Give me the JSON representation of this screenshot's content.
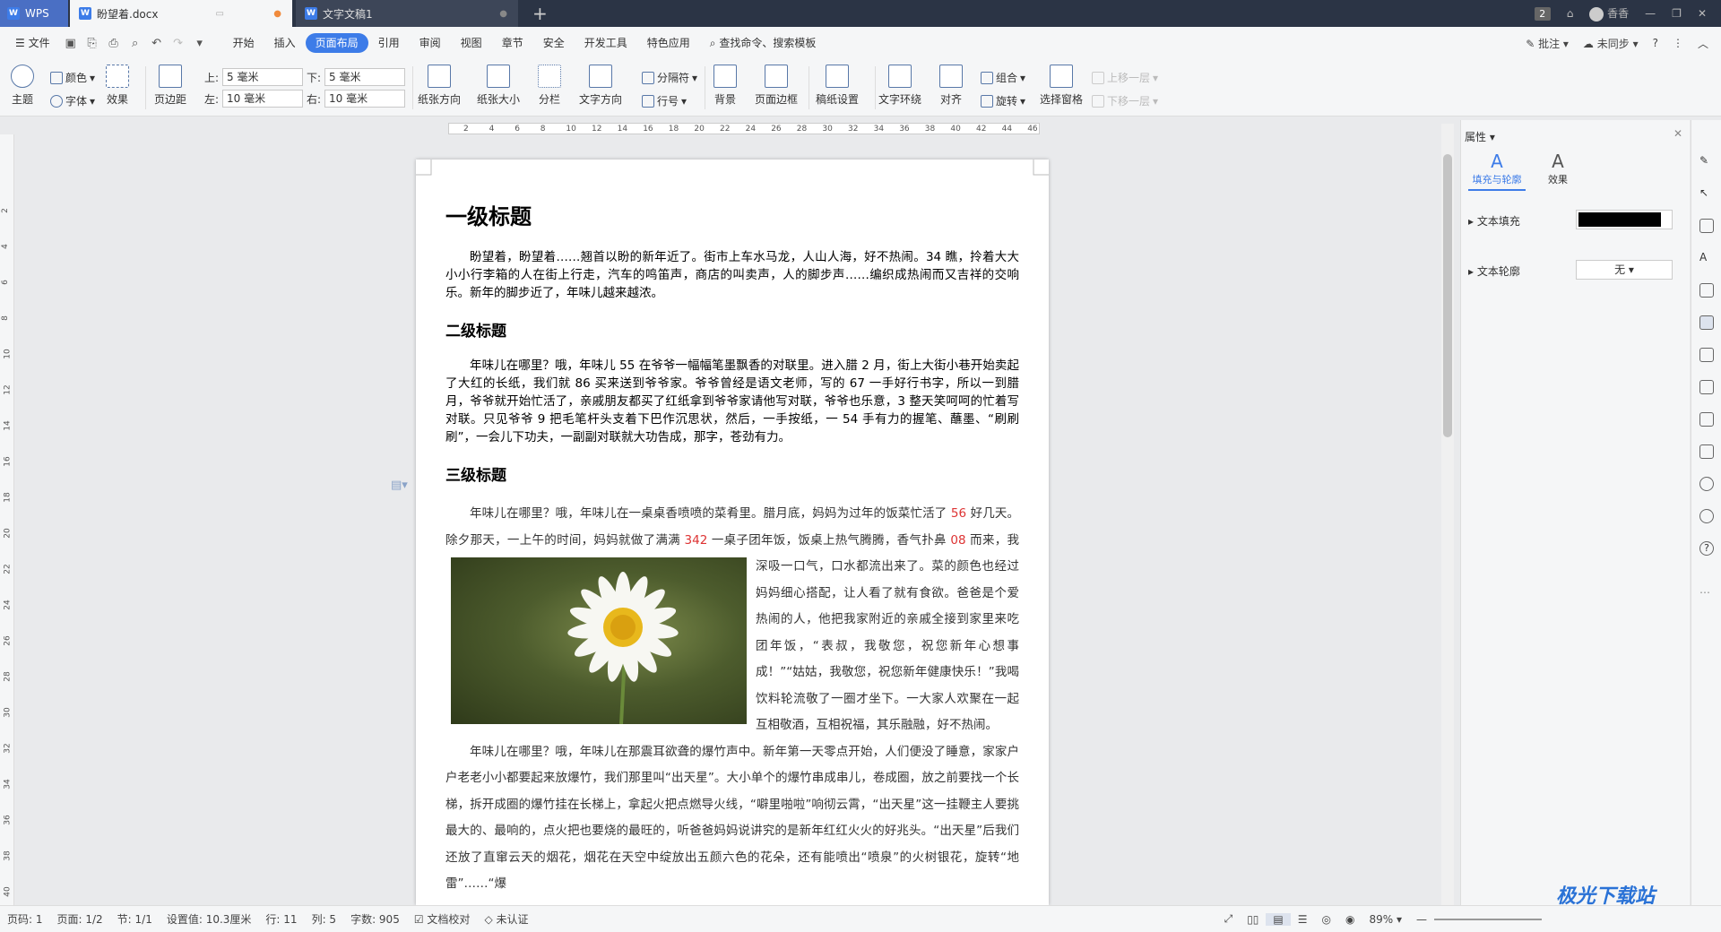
{
  "titlebar": {
    "app_tab": "WPS",
    "doc_tab": "盼望着.docx",
    "doc2_tab": "文字文稿1",
    "window_count": "2",
    "user": "香香"
  },
  "menu": {
    "file": "文件",
    "items": [
      "开始",
      "插入",
      "页面布局",
      "引用",
      "审阅",
      "视图",
      "章节",
      "安全",
      "开发工具",
      "特色应用"
    ],
    "active": "页面布局",
    "search": "查找命令、搜索模板",
    "comment": "批注",
    "sync": "未同步"
  },
  "ribbon": {
    "theme": "主题",
    "color": "颜色",
    "font": "字体",
    "effect": "效果",
    "margin": "页边距",
    "top_label": "上:",
    "top_val": "5 毫米",
    "bottom_label": "下:",
    "bottom_val": "5 毫米",
    "left_label": "左:",
    "left_val": "10 毫米",
    "right_label": "右:",
    "right_val": "10 毫米",
    "orient": "纸张方向",
    "size": "纸张大小",
    "columns": "分栏",
    "text_dir": "文字方向",
    "separator": "分隔符",
    "line_num": "行号",
    "background": "背景",
    "border": "页面边框",
    "grid": "稿纸设置",
    "wrap": "文字环绕",
    "align": "对齐",
    "group": "组合",
    "rotate": "旋转",
    "select_pane": "选择窗格",
    "up": "上移一层",
    "down": "下移一层"
  },
  "ruler": {
    "ticks": [
      "2",
      "4",
      "6",
      "8",
      "10",
      "12",
      "14",
      "16",
      "18",
      "20",
      "22",
      "24",
      "26",
      "28",
      "30",
      "32",
      "34",
      "36",
      "38",
      "40",
      "42",
      "44",
      "46"
    ],
    "vticks": [
      "2",
      "4",
      "6",
      "8",
      "10",
      "12",
      "14",
      "16",
      "18",
      "20",
      "22",
      "24",
      "26",
      "28",
      "30",
      "32",
      "34",
      "36",
      "38",
      "40"
    ]
  },
  "doc": {
    "h1": "一级标题",
    "p1": "盼望着，盼望着……翘首以盼的新年近了。街市上车水马龙，人山人海，好不热闹。34 瞧，拎着大大小小行李箱的人在街上行走，汽车的鸣笛声，商店的叫卖声，人的脚步声……编织成热闹而又吉祥的交响乐。新年的脚步近了，年味儿越来越浓。",
    "h2": "二级标题",
    "p2": "年味儿在哪里？哦，年味儿 55 在爷爷一幅幅笔墨飘香的对联里。进入腊 2 月，街上大街小巷开始卖起了大红的长纸，我们就 86 买来送到爷爷家。爷爷曾经是语文老师，写的 67 一手好行书字，所以一到腊月，爷爷就开始忙活了，亲戚朋友都买了红纸拿到爷爷家请他写对联，爷爷也乐意，3 整天笑呵呵的忙着写对联。只见爷爷 9 把毛笔杆头支着下巴作沉思状，然后，一手按纸，一 54 手有力的握笔、蘸墨、“刷刷刷”，一会儿下功夫，一副副对联就大功告成，那字，苍劲有力。",
    "h3": "三级标题",
    "p3a": "年味儿在哪里？哦，年味儿在一桌桌香喷喷的菜肴里。腊月底，妈妈为过年的饭菜忙活了",
    "n56": "56",
    "p3b": "好几天。除夕那天，一上午的时间，妈妈就做了满满",
    "n342": "342",
    "p3c": "一桌子团年饭，饭桌上热气腾腾，香气扑鼻",
    "n08": "08",
    "p3d": "而来，我深吸一口气，口水都流出来了。菜的颜色也经过妈妈细心搭配，让人看了就有食欲。爸爸是个爱热闹的人，他把我家附近的亲戚全接到家里来吃团年饭，“表叔，我敬您，祝您新年心想事成！”“姑姑，我敬您，祝您新年健康快乐！”我喝饮料轮流敬了一圈才坐下。一大家人欢聚在一起互相敬酒，互相祝福，其乐融融，好不热闹。",
    "p4": "年味儿在哪里？哦，年味儿在那震耳欲聋的爆竹声中。新年第一天零点开始，人们便没了睡意，家家户户老老小小都要起来放爆竹，我们那里叫“出天星”。大小单个的爆竹串成串儿，卷成圈，放之前要找一个长梯，拆开成圈的爆竹挂在长梯上，拿起火把点燃导火线，“噼里啪啦”响彻云霄，“出天星”这一挂鞭主人要挑最大的、最响的，点火把也要烧的最旺的，听爸爸妈妈说讲究的是新年红红火火的好兆头。“出天星”后我们还放了直窜云天的烟花，烟花在天空中绽放出五颜六色的花朵，还有能喷出“喷泉”的火树银花，旋转“地雷”……“爆"
  },
  "sidebar": {
    "title": "属性",
    "tab1": "填充与轮廓",
    "tab2": "效果",
    "fill": "文本填充",
    "fill_color": "#000000",
    "outline": "文本轮廓",
    "outline_val": "无"
  },
  "status": {
    "page_no": "页码: 1",
    "page": "页面: 1/2",
    "section": "节: 1/1",
    "setting": "设置值: 10.3厘米",
    "row": "行: 11",
    "col": "列: 5",
    "words": "字数: 905",
    "proof": "文档校对",
    "cert": "未认证",
    "zoom": "89%"
  },
  "watermark": {
    "text": "极光下载站"
  },
  "colors": {
    "accent": "#3d7ce8",
    "titlebar": "#2b3445"
  }
}
